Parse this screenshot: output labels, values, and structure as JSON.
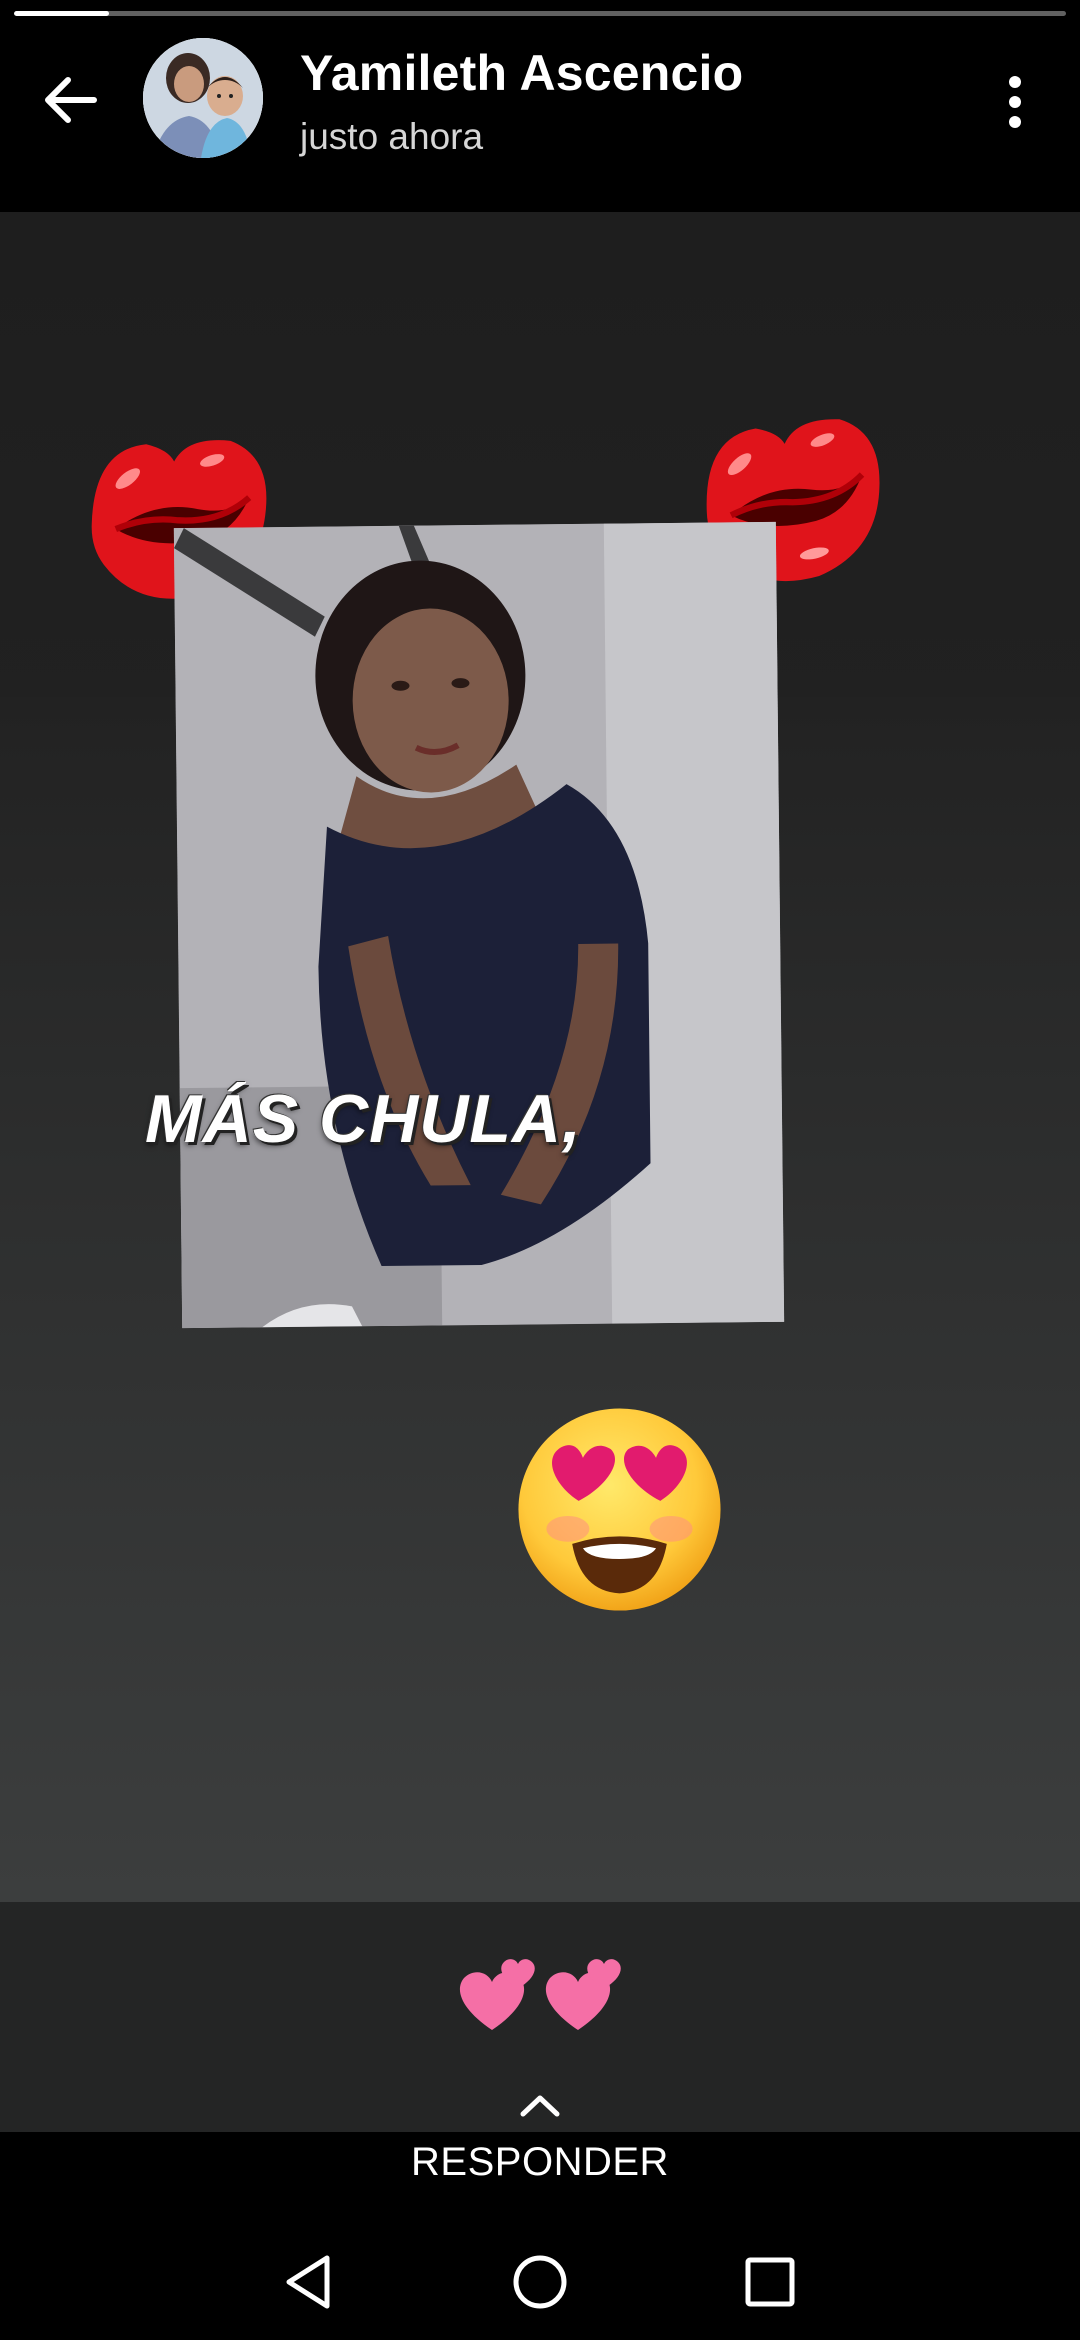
{
  "progress": {
    "fraction": 0.09
  },
  "header": {
    "username": "Yamileth Ascencio",
    "timestamp": "justo ahora",
    "back_icon": "arrow-left-icon",
    "more_icon": "more-vertical-icon"
  },
  "story": {
    "overlay_text": "MÁS CHULA,",
    "stickers": [
      "kiss-mark-icon",
      "kiss-mark-icon",
      "heart-eyes-icon",
      "two-hearts-icon"
    ]
  },
  "reply": {
    "label": "RESPONDER",
    "icon": "chevron-up-icon"
  },
  "navbar": {
    "icons": [
      "nav-back-icon",
      "nav-home-icon",
      "nav-recents-icon"
    ]
  },
  "colors": {
    "background": "#000000",
    "story_bg": "#2b2c2c",
    "kiss_red": "#e0141b",
    "heart_pink": "#f06292"
  }
}
